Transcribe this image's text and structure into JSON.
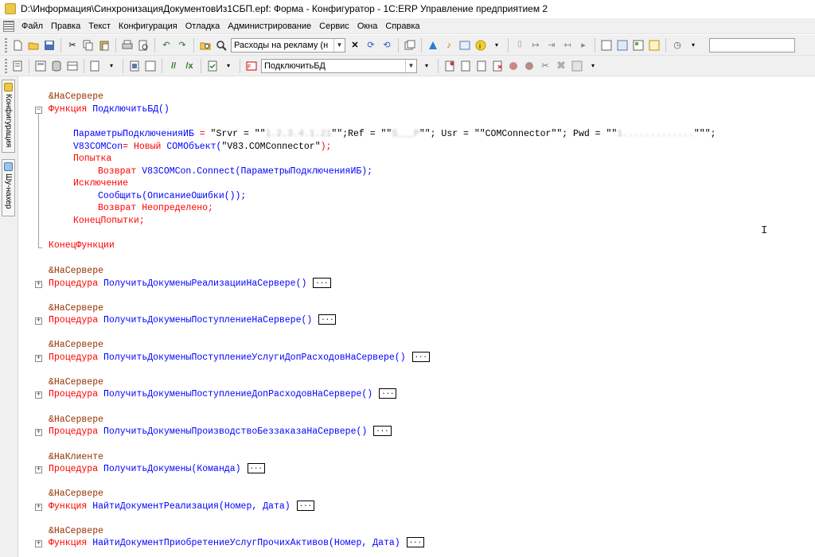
{
  "window": {
    "title": "D:\\Информация\\СинхронизацияДокументовИз1СБП.epf: Форма - Конфигуратор - 1С:ERP Управление предприятием 2"
  },
  "menu": [
    "Файл",
    "Правка",
    "Текст",
    "Конфигурация",
    "Отладка",
    "Администрирование",
    "Сервис",
    "Окна",
    "Справка"
  ],
  "toolbar1": {
    "combo_value": "Расходы на рекламу (н"
  },
  "toolbar2": {
    "combo_value": "ПодключитьБД"
  },
  "side_tabs": [
    "Конфигурация",
    "Шу-нахер"
  ],
  "code": {
    "dir1": "&НаСервере",
    "func_kw": "Функция",
    "func_name": "ПодключитьБД()",
    "l1_var": "ПараметрыПодключенияИБ",
    "l1_eq": " = ",
    "l1_s1": "\"Srvr = \"\"",
    "l1_b1": "1.2.3.4.1.21",
    "l1_s2": "\"\";Ref = \"\"",
    "l1_b2": "S___P",
    "l1_s3": "\"\"; Usr = \"\"COMConnector\"\"; Pwd = \"\"",
    "l1_b3": "1.............",
    "l1_s4": "\"\"\";",
    "l2_var": "V83COMCon",
    "l2_eq": "= ",
    "l2_kw": "Новый ",
    "l2_fn": "COMОбъект(",
    "l2_str": "\"V83.COMConnector\"",
    "l2_end": ");",
    "try_kw": "Попытка",
    "ret_kw": "Возврат ",
    "ret_expr": "V83COMCon.Connect(ПараметрыПодключенияИБ);",
    "exc_kw": "Исключение",
    "msg_fn": "Сообщить(ОписаниеОшибки());",
    "ret2_kw": "Возврат ",
    "ret2_val": "Неопределено;",
    "endtry_kw": "КонецПопытки;",
    "endfunc_kw": "КонецФункции",
    "procs": [
      {
        "dir": "&НаСервере",
        "kw": "Процедура",
        "name": "ПолучитьДокуменыРеализацииНаСервере()"
      },
      {
        "dir": "&НаСервере",
        "kw": "Процедура",
        "name": "ПолучитьДокуменыПоступлениеНаСервере()"
      },
      {
        "dir": "&НаСервере",
        "kw": "Процедура",
        "name": "ПолучитьДокуменыПоступлениеУслугиДопРасходовНаСервере()"
      },
      {
        "dir": "&НаСервере",
        "kw": "Процедура",
        "name": "ПолучитьДокуменыПоступлениеДопРасходовНаСервере()"
      },
      {
        "dir": "&НаСервере",
        "kw": "Процедура",
        "name": "ПолучитьДокуменыПроизводствоБеззаказаНаСервере()"
      },
      {
        "dir": "&НаКлиенте",
        "kw": "Процедура",
        "name": "ПолучитьДокумены(Команда)"
      },
      {
        "dir": "&НаСервере",
        "kw": "Функция",
        "name": "НайтиДокументРеализация(Номер, Дата)"
      },
      {
        "dir": "&НаСервере",
        "kw": "Функция",
        "name": "НайтиДокументПриобретениеУслугПрочихАктивов(Номер, Дата)"
      }
    ],
    "collapsed_marker": "..."
  }
}
